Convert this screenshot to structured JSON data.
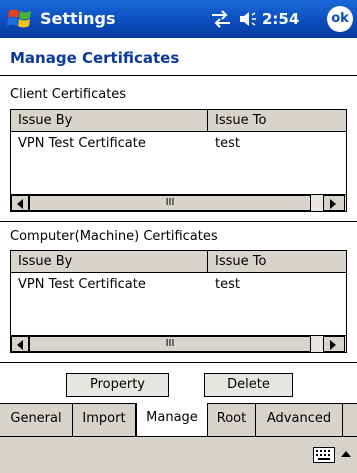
{
  "titlebar": {
    "title": "Settings",
    "clock": "2:54",
    "ok_label": "ok"
  },
  "page_title": "Manage Certificates",
  "client_section": {
    "label": "Client Certificates",
    "columns": [
      "Issue By",
      "Issue To"
    ],
    "rows": [
      [
        "VPN Test Certificate",
        "test"
      ]
    ]
  },
  "machine_section": {
    "label": "Computer(Machine) Certificates",
    "columns": [
      "Issue By",
      "Issue To"
    ],
    "rows": [
      [
        "VPN Test Certificate",
        "test"
      ]
    ]
  },
  "buttons": {
    "property": "Property",
    "delete": "Delete"
  },
  "tabs": [
    {
      "label": "General"
    },
    {
      "label": "Import"
    },
    {
      "label": "Manage"
    },
    {
      "label": "Root"
    },
    {
      "label": "Advanced"
    }
  ],
  "active_tab": "Manage",
  "scroll_thumb_glyph": "III"
}
